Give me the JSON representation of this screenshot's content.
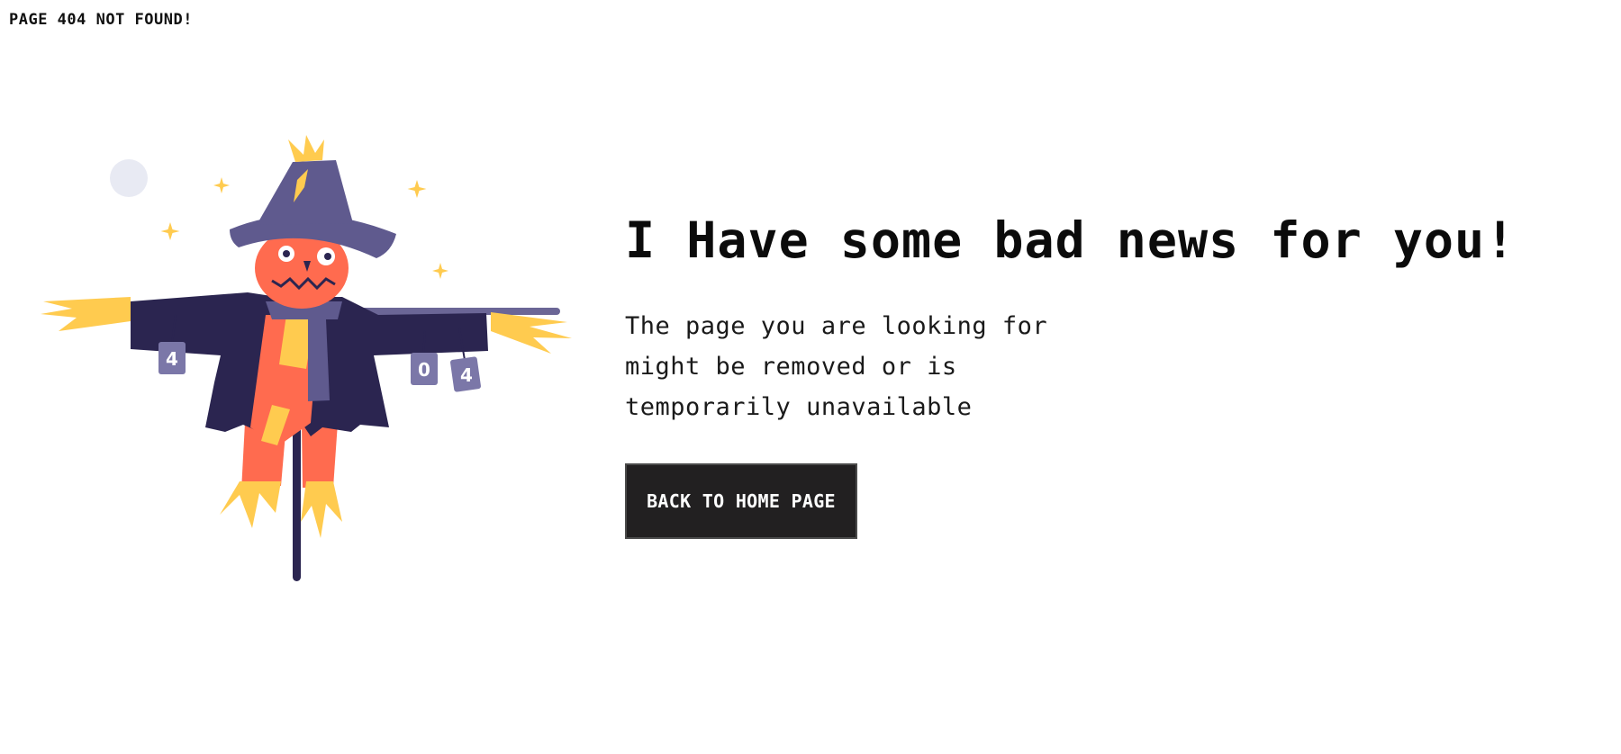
{
  "page": {
    "top_label": "PAGE 404 NOT FOUND!"
  },
  "main": {
    "headline": "I Have some bad news for you!",
    "message": "The page you are looking for might be removed or is temporarily unavailable",
    "button_label": "BACK TO HOME PAGE"
  },
  "illustration": {
    "name": "scarecrow",
    "cans": [
      "4",
      "0",
      "4"
    ],
    "colors": {
      "hat": "#5f5a8e",
      "coat": "#2b2550",
      "face": "#ff6b4f",
      "straw": "#ffcb4f",
      "moon": "#e8eaf3",
      "pole": "#2b2550",
      "can": "#7b77a8"
    }
  },
  "colors": {
    "background": "#ffffff",
    "text": "#111111",
    "button_bg": "#222021",
    "button_text": "#ffffff"
  }
}
